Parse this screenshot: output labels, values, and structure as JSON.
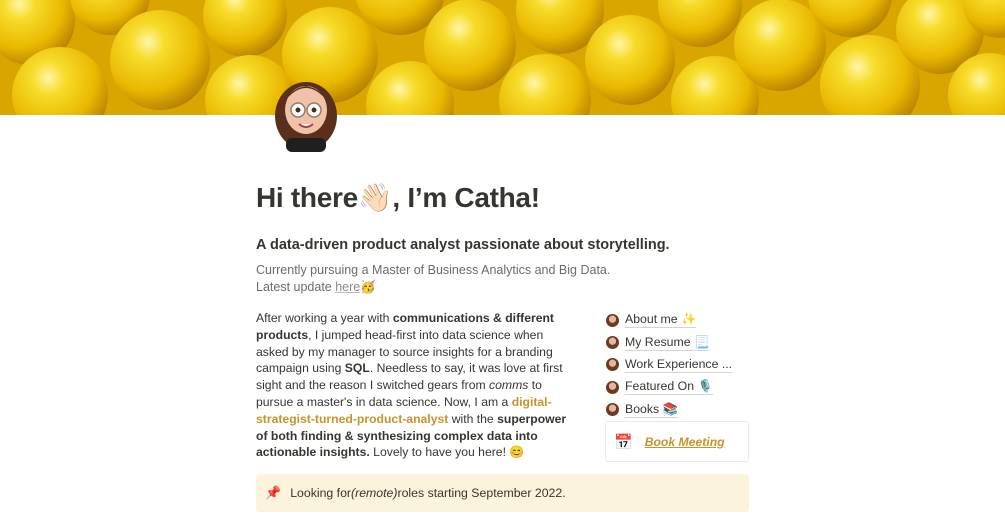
{
  "header": {
    "title": "Hi there👋🏻, I’m Catha!",
    "subtitle": "A data-driven product analyst passionate about storytelling."
  },
  "meta": {
    "line1": "Currently pursuing a Master of Business Analytics and Big Data.",
    "line2_prefix": "Latest update ",
    "line2_link": "here",
    "line2_emoji": "🥳"
  },
  "intro": {
    "p1_a": "After working a year with ",
    "p1_b": "communications & different products",
    "p1_c": ", I jumped head-first into data science when asked by my manager to source insights for a branding campaign using ",
    "p1_d": "SQL",
    "p1_e": ". Needless to say, it was love at first sight and the reason I switched gears from ",
    "p1_f": "comms",
    "p1_g": " to pursue a master's in data science. Now, I am a ",
    "p1_link": "digital-strategist-turned-product-analyst",
    "p1_h": " with the ",
    "p1_i": "superpower of both finding & synthesizing complex data into actionable insights.",
    "p1_j": " Lovely to have you here! 😊"
  },
  "sidebar": {
    "items": [
      {
        "label": "About me ✨"
      },
      {
        "label": "My Resume 📃"
      },
      {
        "label": "Work Experience ..."
      },
      {
        "label": "Featured On 🎙️"
      },
      {
        "label": "Books 📚"
      }
    ],
    "book": {
      "icon": "📅",
      "label": "Book Meeting"
    }
  },
  "callout": {
    "icon": "📌",
    "prefix": "Looking for ",
    "italic": "(remote)",
    "suffix": " roles starting September 2022."
  },
  "colors": {
    "accent": "#c6942d",
    "callout_bg": "#fbf3db",
    "text": "#37352f"
  }
}
